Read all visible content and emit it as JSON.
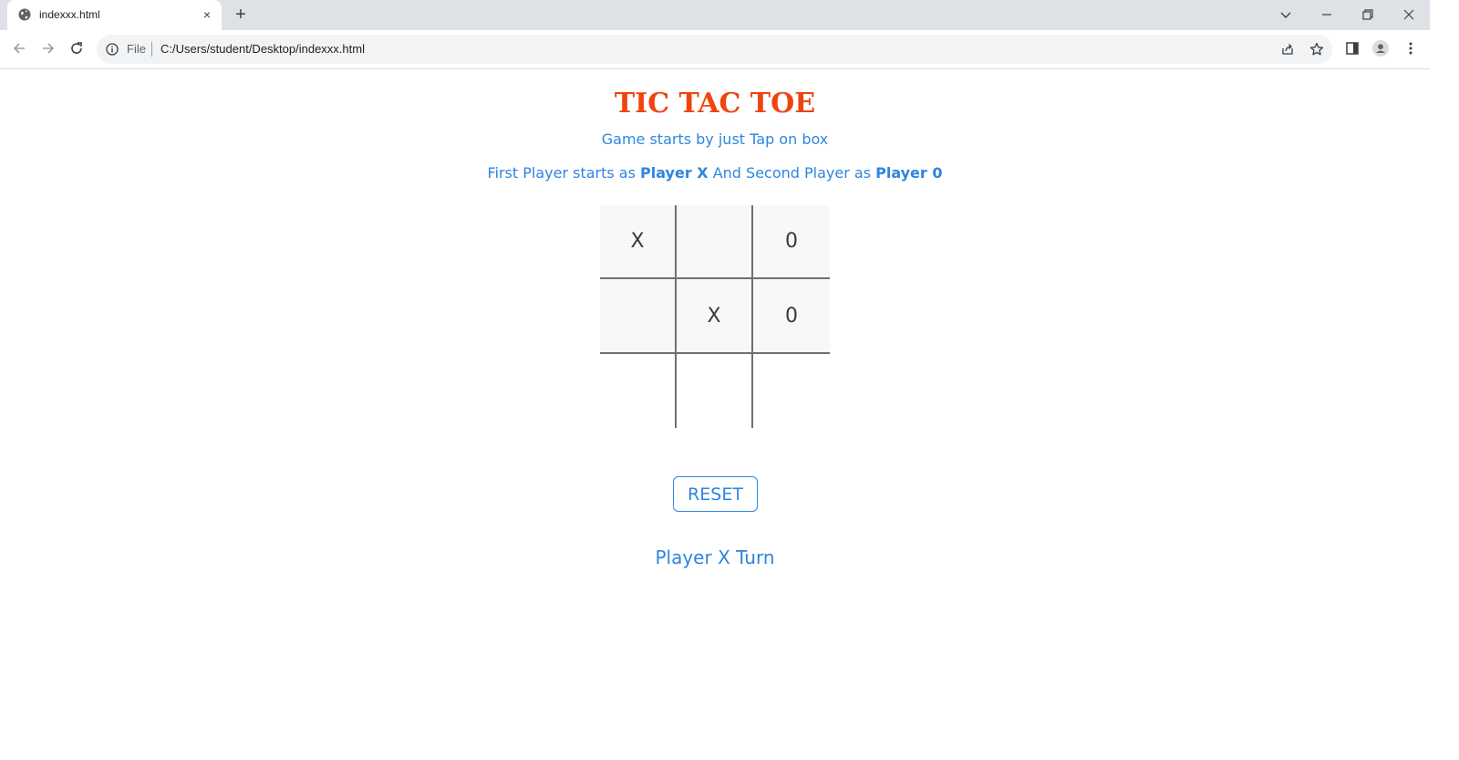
{
  "browser": {
    "tab_title": "indexxx.html",
    "new_tab_symbol": "+",
    "close_symbol": "×",
    "address": {
      "scheme_label": "File",
      "url": "C:/Users/student/Desktop/indexxx.html"
    }
  },
  "game": {
    "title": "TIC TAC TOE",
    "subtitle": "Game starts by just Tap on box",
    "instructions": {
      "part1": "First Player starts as ",
      "player1": "Player X",
      "part2": " And Second Player as ",
      "player2": "Player 0"
    },
    "board": {
      "cells": [
        [
          "X",
          "",
          "0"
        ],
        [
          "",
          "X",
          "0"
        ],
        [
          "",
          "",
          ""
        ]
      ]
    },
    "reset_label": "RESET",
    "turn_text": "Player X Turn"
  },
  "colors": {
    "title": "#f0440f",
    "accent": "#2e86de",
    "cell_text": "#3a3a3a",
    "grid_line": "#707070"
  }
}
